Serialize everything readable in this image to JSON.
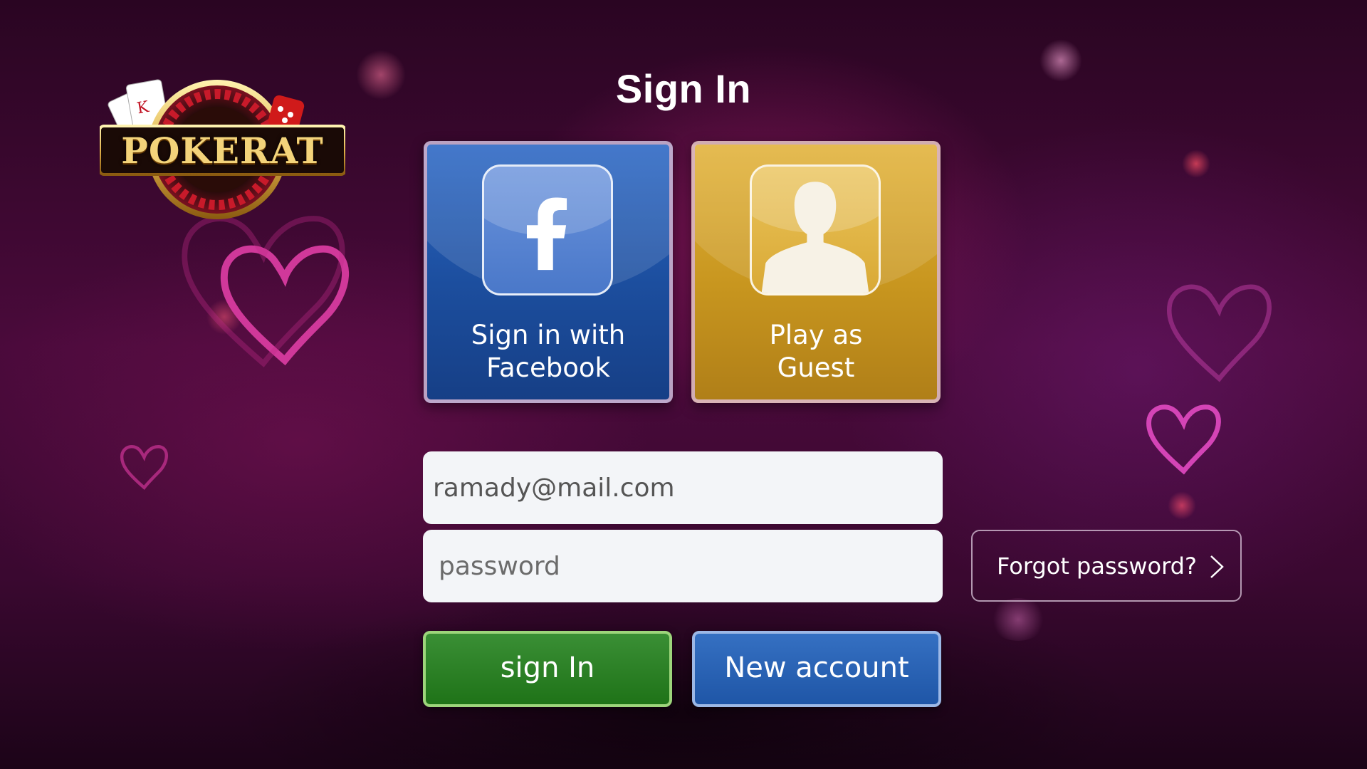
{
  "brand": {
    "logo_text": "POKERAT"
  },
  "header": {
    "title": "Sign In"
  },
  "login_options": {
    "facebook_label": "Sign in with Facebook",
    "facebook_line1": "Sign in with",
    "facebook_line2": "Facebook",
    "guest_label": "Play as Guest",
    "guest_line1": "Play as",
    "guest_line2": "Guest"
  },
  "form": {
    "email_value": "ramady@mail.com",
    "password_placeholder": "password"
  },
  "links": {
    "forgot_password": "Forgot password?"
  },
  "actions": {
    "sign_in": "sign In",
    "new_account": "New account"
  },
  "colors": {
    "facebook_tile": "#1c4e9e",
    "guest_tile": "#c8961f",
    "sign_in_button": "#1f7318",
    "new_account_button": "#1f56a7",
    "background": "#4a0a3b"
  },
  "icons": {
    "facebook": "facebook-icon",
    "guest": "guest-user-icon",
    "forgot_chevron": "chevron-right-icon"
  }
}
